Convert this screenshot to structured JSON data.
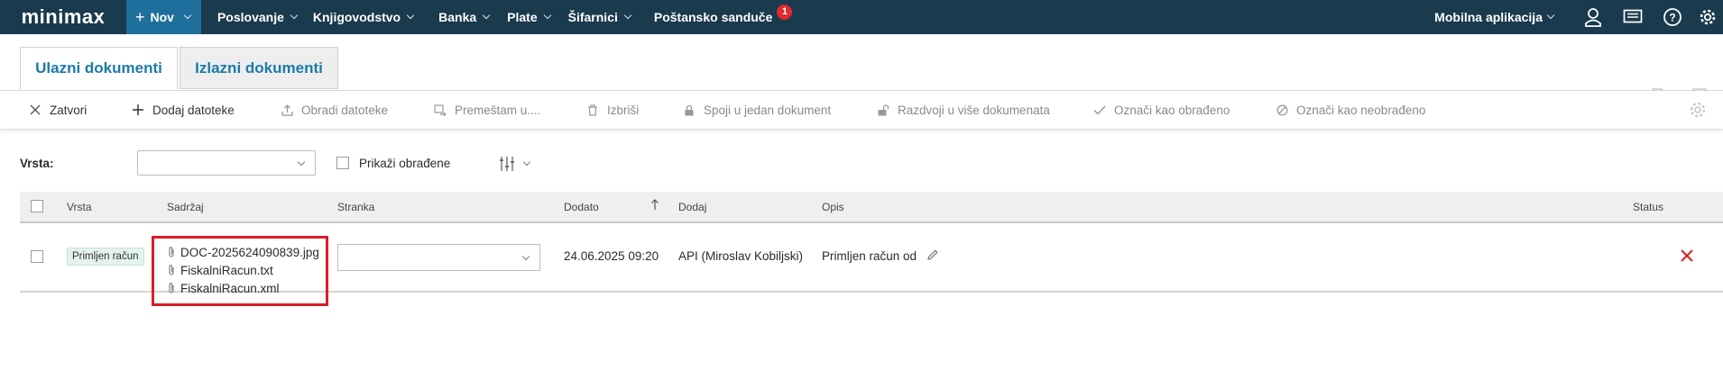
{
  "topbar": {
    "logo": "minimax",
    "new_label": "Nov",
    "menu": [
      "Poslovanje",
      "Knjigovodstvo",
      "Banka",
      "Plate",
      "Šifarnici"
    ],
    "mailbox_label": "Poštansko sandučе",
    "mailbox_badge": "1",
    "mobile_app_label": "Mobilna aplikacija",
    "icons": [
      "user-icon",
      "messages-icon",
      "help-icon",
      "settings-icon"
    ],
    "bg_color": "#1a3a4d",
    "accent_color": "#1f6f9c"
  },
  "tabs": {
    "incoming": "Ulazni dokumenti",
    "outgoing": "Izlazni dokumenti"
  },
  "toolbar": {
    "close": "Zatvori",
    "add_files": "Dodaj datoteke",
    "process_files": "Obradi datoteke",
    "move": "Premeštam u....",
    "delete": "Izbriši",
    "merge": "Spoji u jedan dokument",
    "split": "Razdvoji u više dokumenata",
    "mark_processed": "Označi kao obrađeno",
    "mark_unprocessed": "Označi kao neobrađeno"
  },
  "filter": {
    "type_label": "Vrsta:",
    "type_value": "",
    "show_processed_label": "Prikaži obrađene",
    "show_processed_checked": false
  },
  "table": {
    "columns": {
      "type": "Vrsta",
      "content": "Sadržaj",
      "partner": "Stranka",
      "added": "Dodato",
      "added_by": "Dodaj",
      "description": "Opis",
      "status": "Status"
    },
    "rows": [
      {
        "type": "Primljen račun",
        "files": [
          "DOC-2025624090839.jpg",
          "FiskalniRacun.txt",
          "FiskalniRacun.xml"
        ],
        "partner": "",
        "added": "24.06.2025 09:20",
        "added_by": "API (Miroslav Kobiljski)",
        "description": "Primljen račun od",
        "status": "error",
        "status_color": "#d91f26"
      }
    ]
  }
}
